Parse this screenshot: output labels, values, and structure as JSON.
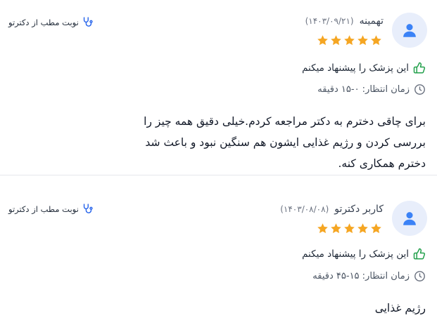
{
  "reviews": [
    {
      "user_name": "تهمینه",
      "date": "(۱۴۰۳/۰۹/۲۱)",
      "rating": 5,
      "booking_label": "نوبت مطب از دکترتو",
      "recommend_text": "این پزشک را پیشنهاد میکنم",
      "wait_text": "زمان انتظار: ۰-۱۵ دقیقه",
      "comment": "برای چاقی دخترم به دکتر مراجعه کردم.خیلی دقیق همه چیز را بررسی کردن و رژیم غذایی ایشون هم سنگین نبود و باعث شد دخترم همکاری کنه."
    },
    {
      "user_name": "کاربر دکترتو",
      "date": "(۱۴۰۳/۰۸/۰۸)",
      "rating": 5,
      "booking_label": "نوبت مطب از دکترتو",
      "recommend_text": "این پزشک را پیشنهاد میکنم",
      "wait_text": "زمان انتظار: ۱۵-۴۵ دقیقه",
      "comment": "رژیم غذایی"
    }
  ],
  "colors": {
    "star": "#f5a623",
    "thumb": "#22a04b",
    "avatar_bg": "#e8eefb",
    "avatar_fg": "#3b82f6",
    "stethoscope": "#2563eb"
  },
  "icons": {
    "avatar": "user-icon",
    "star": "star-icon",
    "thumb": "thumbs-up-icon",
    "clock": "clock-icon",
    "stethoscope": "stethoscope-icon"
  }
}
